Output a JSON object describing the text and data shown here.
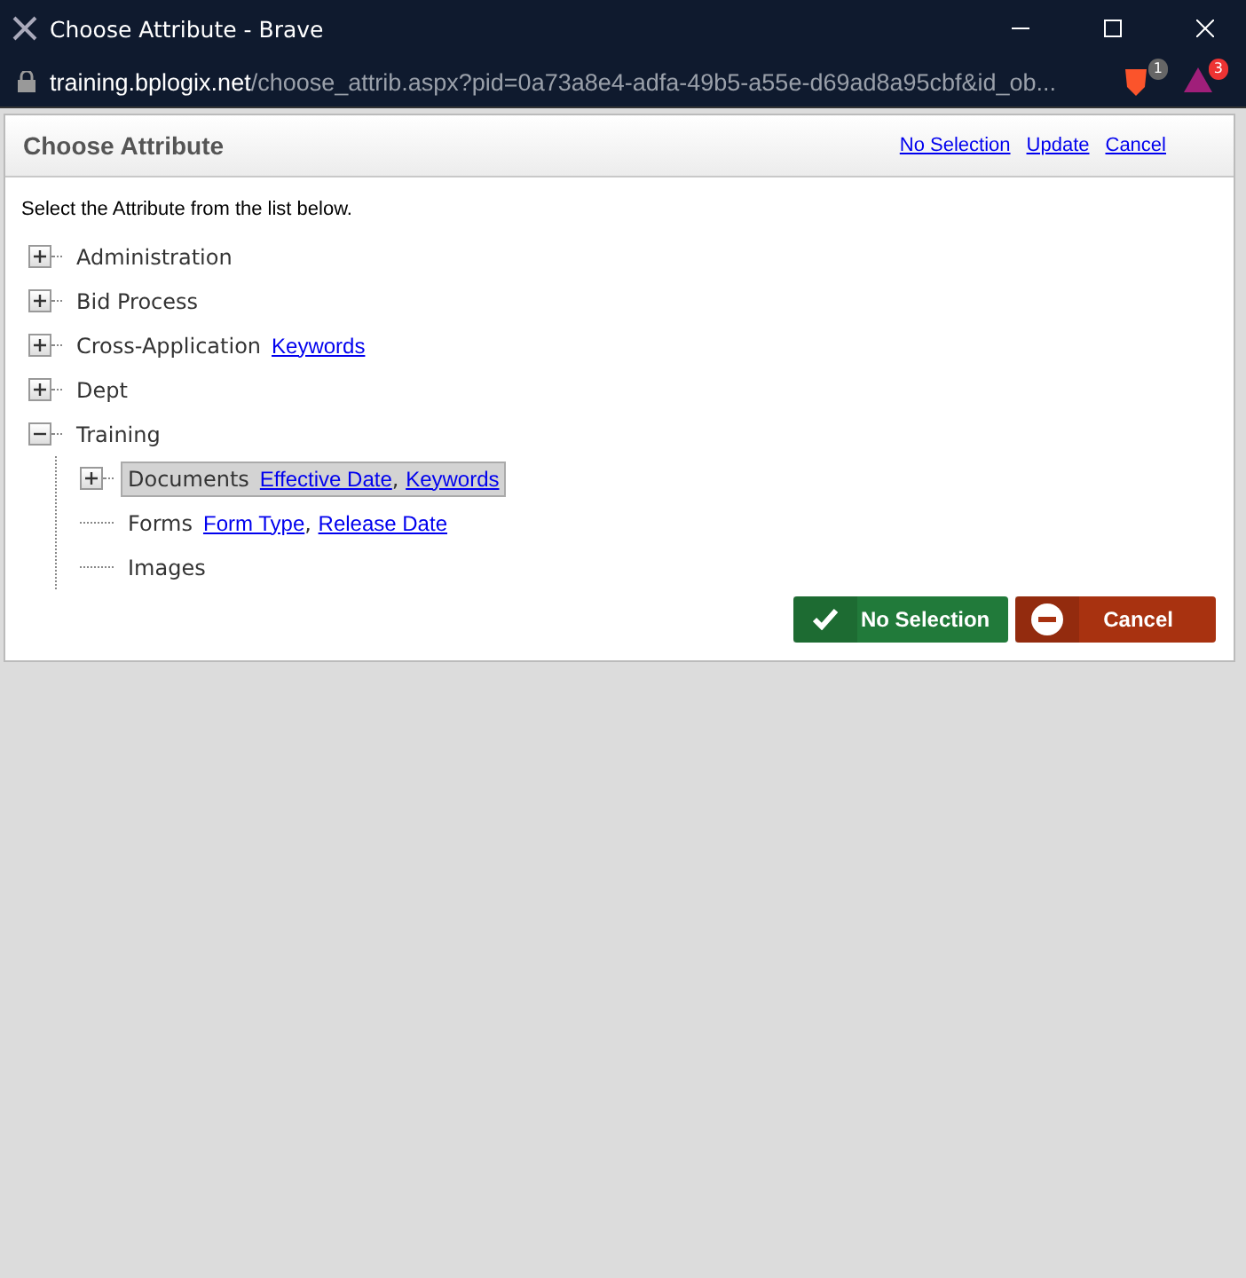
{
  "window": {
    "title": "Choose Attribute - Brave"
  },
  "address_bar": {
    "domain": "training.bplogix.net",
    "path": "/choose_attrib.aspx?pid=0a73a8e4-adfa-49b5-a55e-d69ad8a95cbf&id_ob...",
    "shield_badge": "1",
    "rewards_badge": "3"
  },
  "dialog": {
    "title": "Choose Attribute",
    "header_links": [
      "No Selection",
      "Update",
      "Cancel"
    ],
    "instruction": "Select the Attribute from the list below.",
    "tree": [
      {
        "label": "Administration",
        "expanded": false,
        "selected": false
      },
      {
        "label": "Bid Process",
        "expanded": false,
        "selected": false
      },
      {
        "label": "Cross-Application",
        "expanded": false,
        "selected": false,
        "links": [
          {
            "text": "Keywords"
          }
        ]
      },
      {
        "label": "Dept",
        "expanded": false,
        "selected": false
      },
      {
        "label": "Training",
        "expanded": true,
        "selected": false,
        "children": [
          {
            "label": "Documents",
            "expanded": false,
            "selected": true,
            "links": [
              {
                "text": "Effective Date",
                "separator": ","
              },
              {
                "text": "Keywords"
              }
            ]
          },
          {
            "label": "Forms",
            "selected": false,
            "links": [
              {
                "text": "Form Type",
                "separator": ","
              },
              {
                "text": "Release Date"
              }
            ]
          },
          {
            "label": "Images",
            "selected": false
          }
        ]
      }
    ],
    "buttons": [
      {
        "label": "No Selection",
        "kind": "confirm"
      },
      {
        "label": "Cancel",
        "kind": "cancel"
      }
    ]
  }
}
